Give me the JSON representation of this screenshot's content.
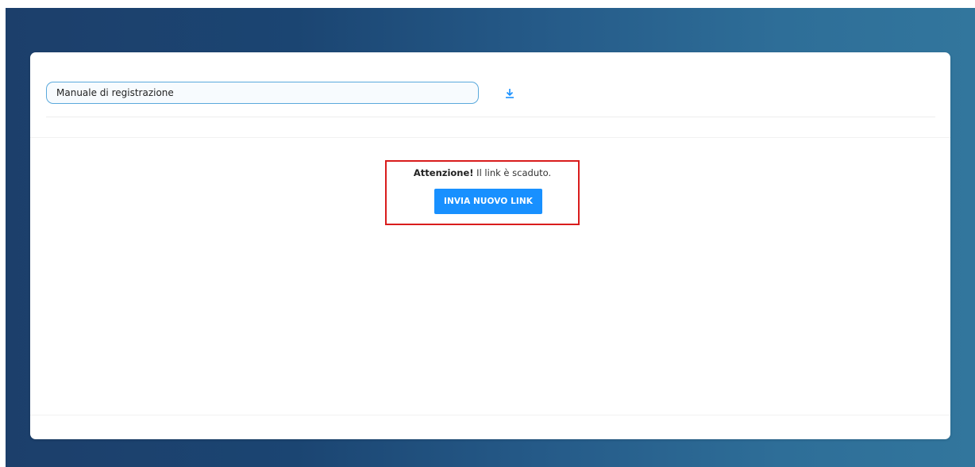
{
  "document_selector": {
    "value": "Manuale di registrazione"
  },
  "download": {
    "icon": "download-icon"
  },
  "alert": {
    "strong": "Attenzione!",
    "message": " Il link è scaduto.",
    "button_label": "INVIA NUOVO LINK"
  },
  "colors": {
    "accent": "#1890ff",
    "highlight": "#d91c1c",
    "background_gradient_start": "#1c3f6b",
    "background_gradient_end": "#32769d"
  }
}
